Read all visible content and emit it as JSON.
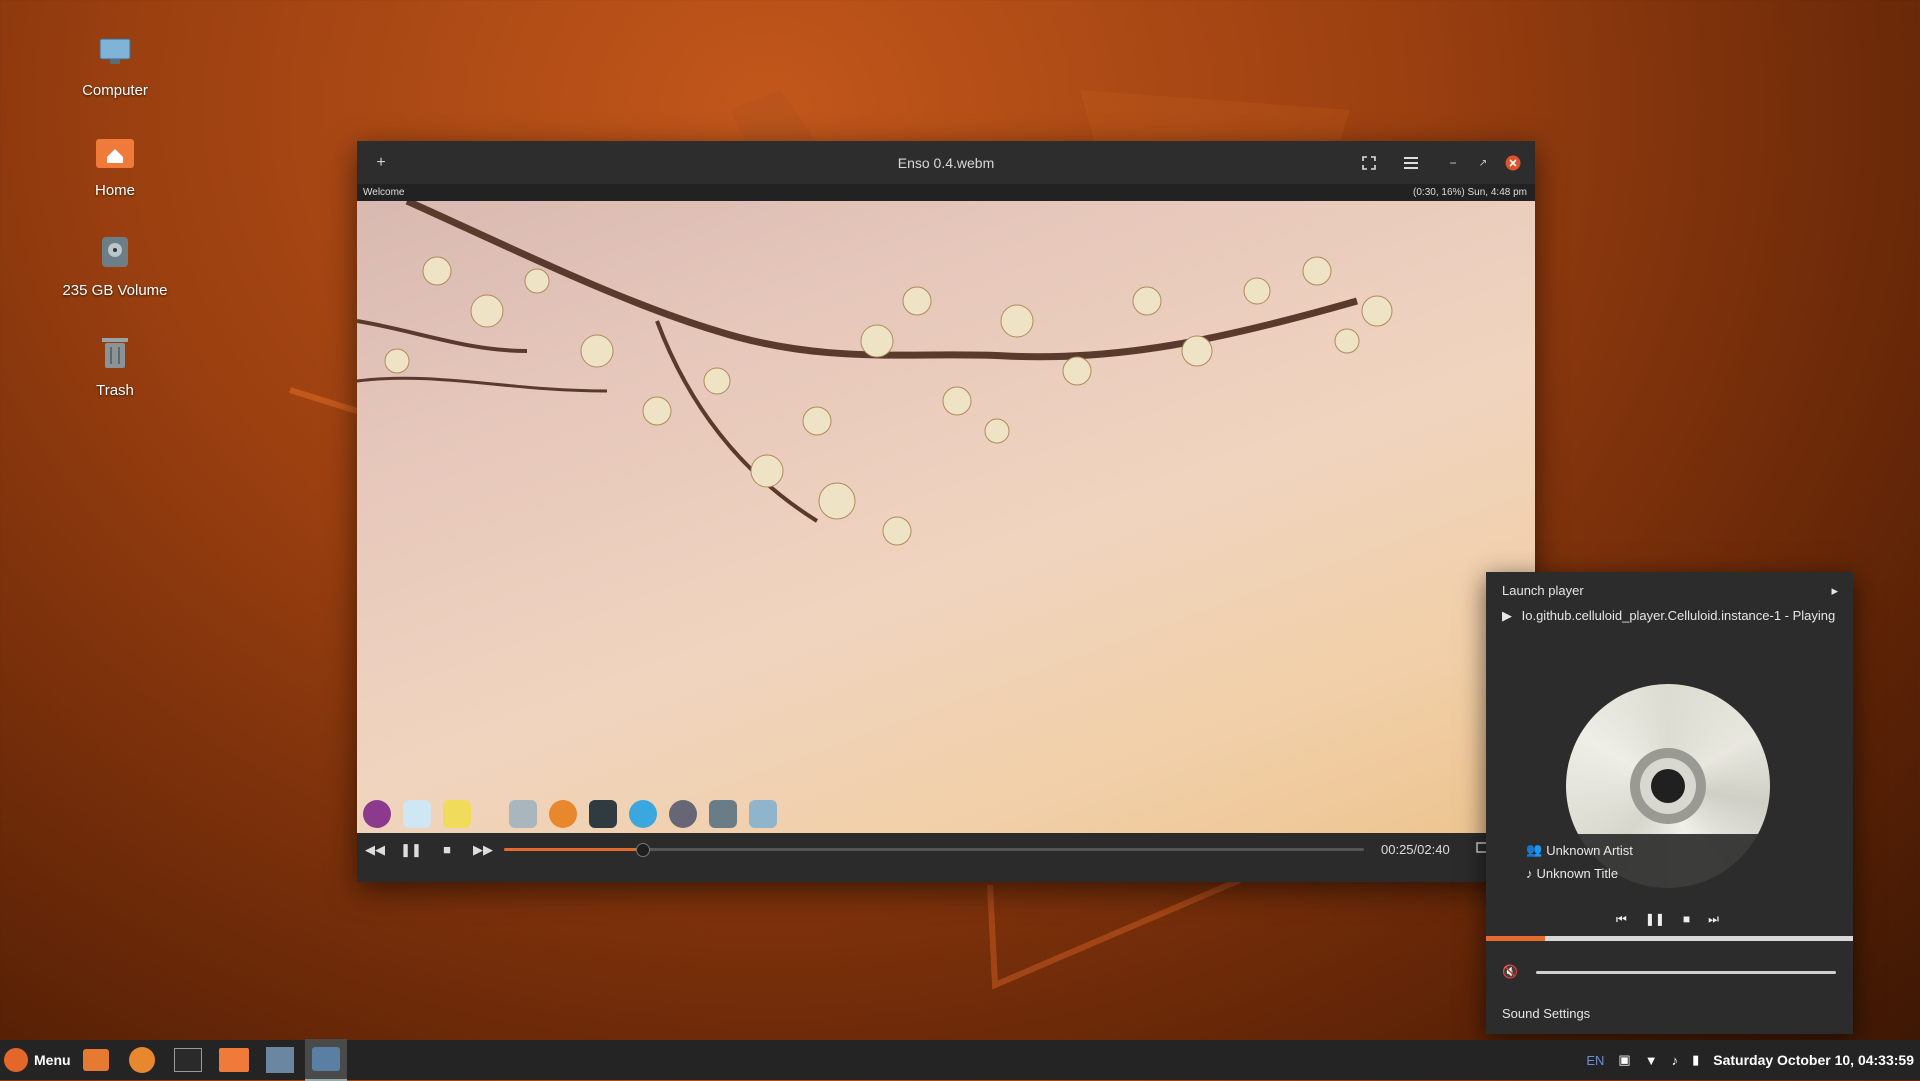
{
  "desktop": {
    "icons": [
      {
        "label": "Computer"
      },
      {
        "label": "Home"
      },
      {
        "label": "235 GB Volume"
      },
      {
        "label": "Trash"
      }
    ]
  },
  "window": {
    "title": "Enso 0.4.webm",
    "inner_panel": {
      "welcome": "Welcome",
      "status": "(0:30, 16%)  Sun, 4:48 pm"
    },
    "playback": {
      "time": "00:25/02:40",
      "progress_fraction": 0.16
    }
  },
  "sound_popup": {
    "launch_player": "Launch player",
    "instance": "Io.github.celluloid_player.Celluloid.instance-1 - Playing",
    "artist": "Unknown Artist",
    "title": "Unknown Title",
    "track_progress_fraction": 0.16,
    "sound_settings": "Sound Settings",
    "colors": {
      "accent": "#e46b2a"
    }
  },
  "taskbar": {
    "menu_label": "Menu",
    "language": "EN",
    "clock": "Saturday October 10, 04:33:59"
  }
}
